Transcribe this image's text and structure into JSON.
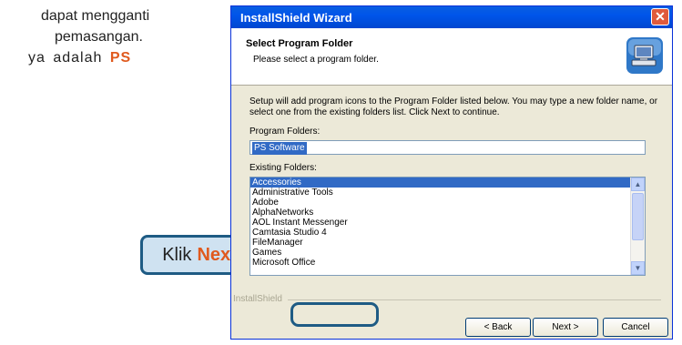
{
  "side_text": {
    "line1": "dapat mengganti",
    "line2": "pemasangan.",
    "line3_prefix": "ya adalah",
    "line3_highlight": "PS"
  },
  "callout": {
    "prefix": "Klik",
    "highlight": "Next"
  },
  "window": {
    "title": "InstallShield Wizard",
    "close_symbol": "✕",
    "header_title": "Select Program Folder",
    "header_subtitle": "Please select a program folder.",
    "header_icon": "computer-setup-icon",
    "description": "Setup will add program icons to the Program Folder listed below.  You may type a new folder name, or select one from the existing folders list.  Click Next to continue.",
    "program_folders_label": "Program Folders:",
    "program_folder_value": "PS Software",
    "existing_folders_label": "Existing Folders:",
    "existing_folders": [
      "Accessories",
      "Administrative Tools",
      "Adobe",
      "AlphaNetworks",
      "AOL Instant Messenger",
      "Camtasia Studio 4",
      "FileManager",
      "Games",
      "Microsoft Office"
    ],
    "selected_folder": "Accessories",
    "brand": "InstallShield",
    "back_label": "< Back",
    "next_label": "Next >",
    "cancel_label": "Cancel"
  },
  "colors": {
    "accent": "#e05a1e",
    "callout_border": "#1e5b84",
    "callout_fill": "#cfe2f1",
    "titlebar": "#0055ea",
    "selection": "#316ac5"
  }
}
